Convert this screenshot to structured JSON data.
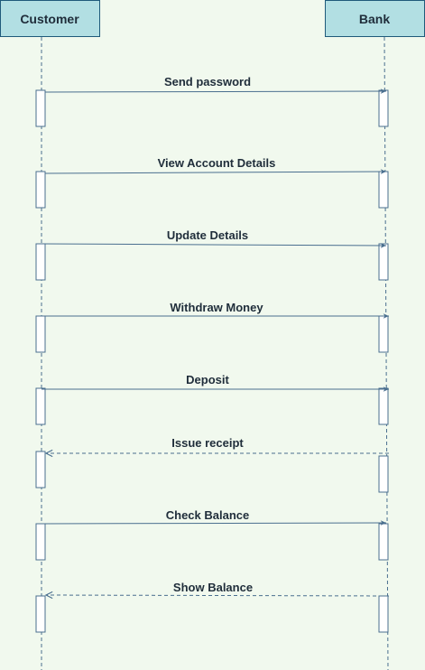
{
  "colors": {
    "background": "#f1f9ee",
    "actor_fill": "#b2dfe3",
    "actor_stroke": "#1f5a7a",
    "line": "#4a6f8f",
    "text": "#1f2d3a",
    "activation_fill": "#ffffff"
  },
  "participants": [
    {
      "id": "customer",
      "label": "Customer"
    },
    {
      "id": "bank",
      "label": "Bank"
    }
  ],
  "messages": [
    {
      "label": "Send password",
      "from": "customer",
      "to": "bank",
      "kind": "sync"
    },
    {
      "label": "View Account Details",
      "from": "customer",
      "to": "bank",
      "kind": "sync"
    },
    {
      "label": "Update Details",
      "from": "customer",
      "to": "bank",
      "kind": "sync"
    },
    {
      "label": "Withdraw Money",
      "from": "customer",
      "to": "bank",
      "kind": "sync"
    },
    {
      "label": "Deposit",
      "from": "customer",
      "to": "bank",
      "kind": "sync"
    },
    {
      "label": "Issue receipt",
      "from": "bank",
      "to": "customer",
      "kind": "return"
    },
    {
      "label": "Check Balance",
      "from": "customer",
      "to": "bank",
      "kind": "sync"
    },
    {
      "label": "Show Balance",
      "from": "bank",
      "to": "customer",
      "kind": "return"
    }
  ]
}
